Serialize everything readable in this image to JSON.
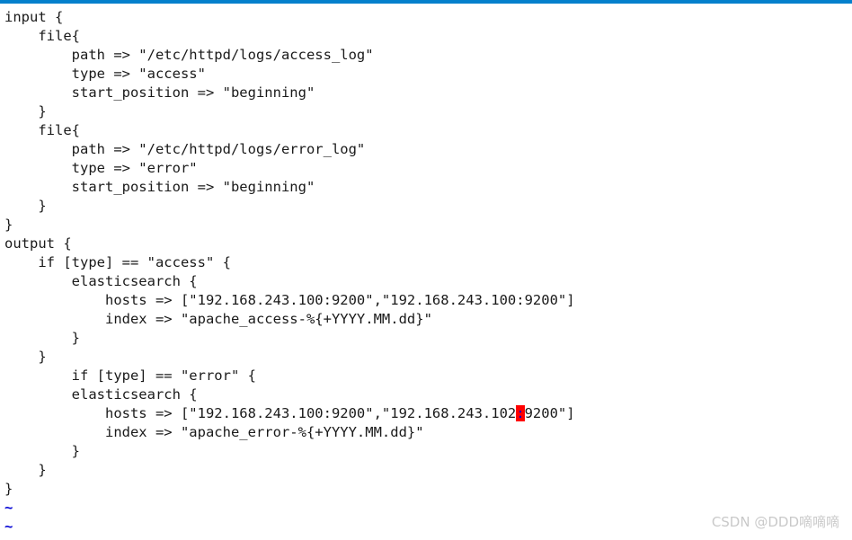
{
  "window": {
    "accent_color": "#0380cc",
    "background_color": "#ffffff",
    "text_color": "#1a1a1a"
  },
  "editor": {
    "cursor": {
      "char": ":",
      "background_color": "#ff0000",
      "foreground_color": "#0000cc",
      "line_index": 21,
      "column_index": 58
    },
    "empty_line_marker": "~",
    "empty_line_marker_color": "#0000d4",
    "lines": [
      "input {",
      "    file{",
      "        path => \"/etc/httpd/logs/access_log\"",
      "        type => \"access\"",
      "        start_position => \"beginning\"",
      "    }",
      "    file{",
      "        path => \"/etc/httpd/logs/error_log\"",
      "        type => \"error\"",
      "        start_position => \"beginning\"",
      "    }",
      "}",
      "output {",
      "    if [type] == \"access\" {",
      "        elasticsearch {",
      "            hosts => [\"192.168.243.100:9200\",\"192.168.243.100:9200\"]",
      "            index => \"apache_access-%{+YYYY.MM.dd}\"",
      "        }",
      "    }",
      "        if [type] == \"error\" {",
      "        elasticsearch {",
      "            hosts => [\"192.168.243.100:9200\",\"192.168.243.102:9200\"]",
      "            index => \"apache_error-%{+YYYY.MM.dd}\"",
      "        }",
      "    }",
      "}"
    ],
    "cursor_line_segments": {
      "before": "            hosts => [\"192.168.243.100:9200\",\"192.168.243.102",
      "cursor": ":",
      "after": "9200\"]"
    },
    "empty_lines": [
      "~",
      "~"
    ]
  },
  "watermark": {
    "text": "CSDN @DDD嘀嘀嘀"
  }
}
